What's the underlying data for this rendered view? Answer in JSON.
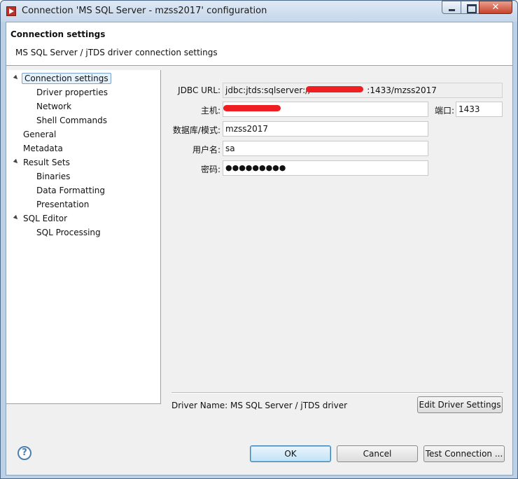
{
  "window": {
    "title": "Connection 'MS SQL Server - mzss2017' configuration",
    "close_glyph": "✕"
  },
  "header": {
    "title": "Connection settings",
    "subtitle": "MS SQL Server / jTDS driver connection settings"
  },
  "tree": {
    "items": [
      {
        "label": "Connection settings",
        "expanded": true,
        "selected": true
      },
      {
        "label": "Driver properties"
      },
      {
        "label": "Network"
      },
      {
        "label": "Shell Commands"
      },
      {
        "label": "General"
      },
      {
        "label": "Metadata"
      },
      {
        "label": "Result Sets",
        "expanded": true
      },
      {
        "label": "Binaries"
      },
      {
        "label": "Data Formatting"
      },
      {
        "label": "Presentation"
      },
      {
        "label": "SQL Editor",
        "expanded": true
      },
      {
        "label": "SQL Processing"
      }
    ]
  },
  "form": {
    "jdbc_label": "JDBC URL:",
    "jdbc_prefix": "jdbc:jtds:sqlserver://",
    "jdbc_suffix": ":1433/mzss2017",
    "host_label": "主机:",
    "host_value": "",
    "port_label": "端口:",
    "port_value": "1433",
    "db_label": "数据库/模式:",
    "db_value": "mzss2017",
    "user_label": "用户名:",
    "user_value": "sa",
    "password_label": "密码:",
    "password_mask": "●●●●●●●●●",
    "driver_name_label": "Driver Name:",
    "driver_name_value": "MS SQL Server / jTDS driver",
    "edit_driver_button": "Edit Driver Settings"
  },
  "footer": {
    "help_glyph": "?",
    "ok": "OK",
    "cancel": "Cancel",
    "test": "Test Connection ..."
  },
  "colors": {
    "redaction": "#ee1e23",
    "selection": "#e5f1fb"
  },
  "icons": {
    "app": "dbeaver-app-icon",
    "help": "help-icon"
  }
}
